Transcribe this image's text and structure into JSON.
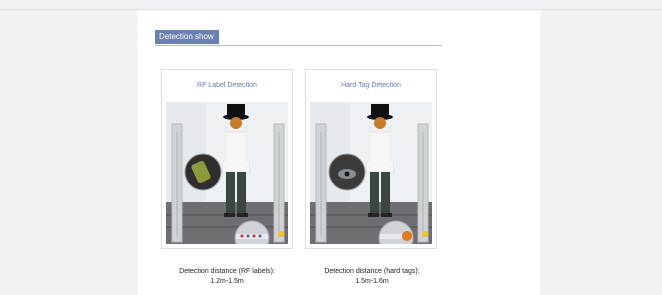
{
  "section": {
    "title": "Detection show"
  },
  "cards": [
    {
      "title": "RF Label Detection",
      "caption_line1": "Detection distance (RF labels):",
      "caption_line2": "1.2m-1.5m"
    },
    {
      "title": "Hard Tag Detection",
      "caption_line1": "Detection distance (hard tags):",
      "caption_line2": "1.5m-1.6m"
    }
  ],
  "colors": {
    "header_bg": "#6a7fb2",
    "title_text": "#6478b0"
  }
}
